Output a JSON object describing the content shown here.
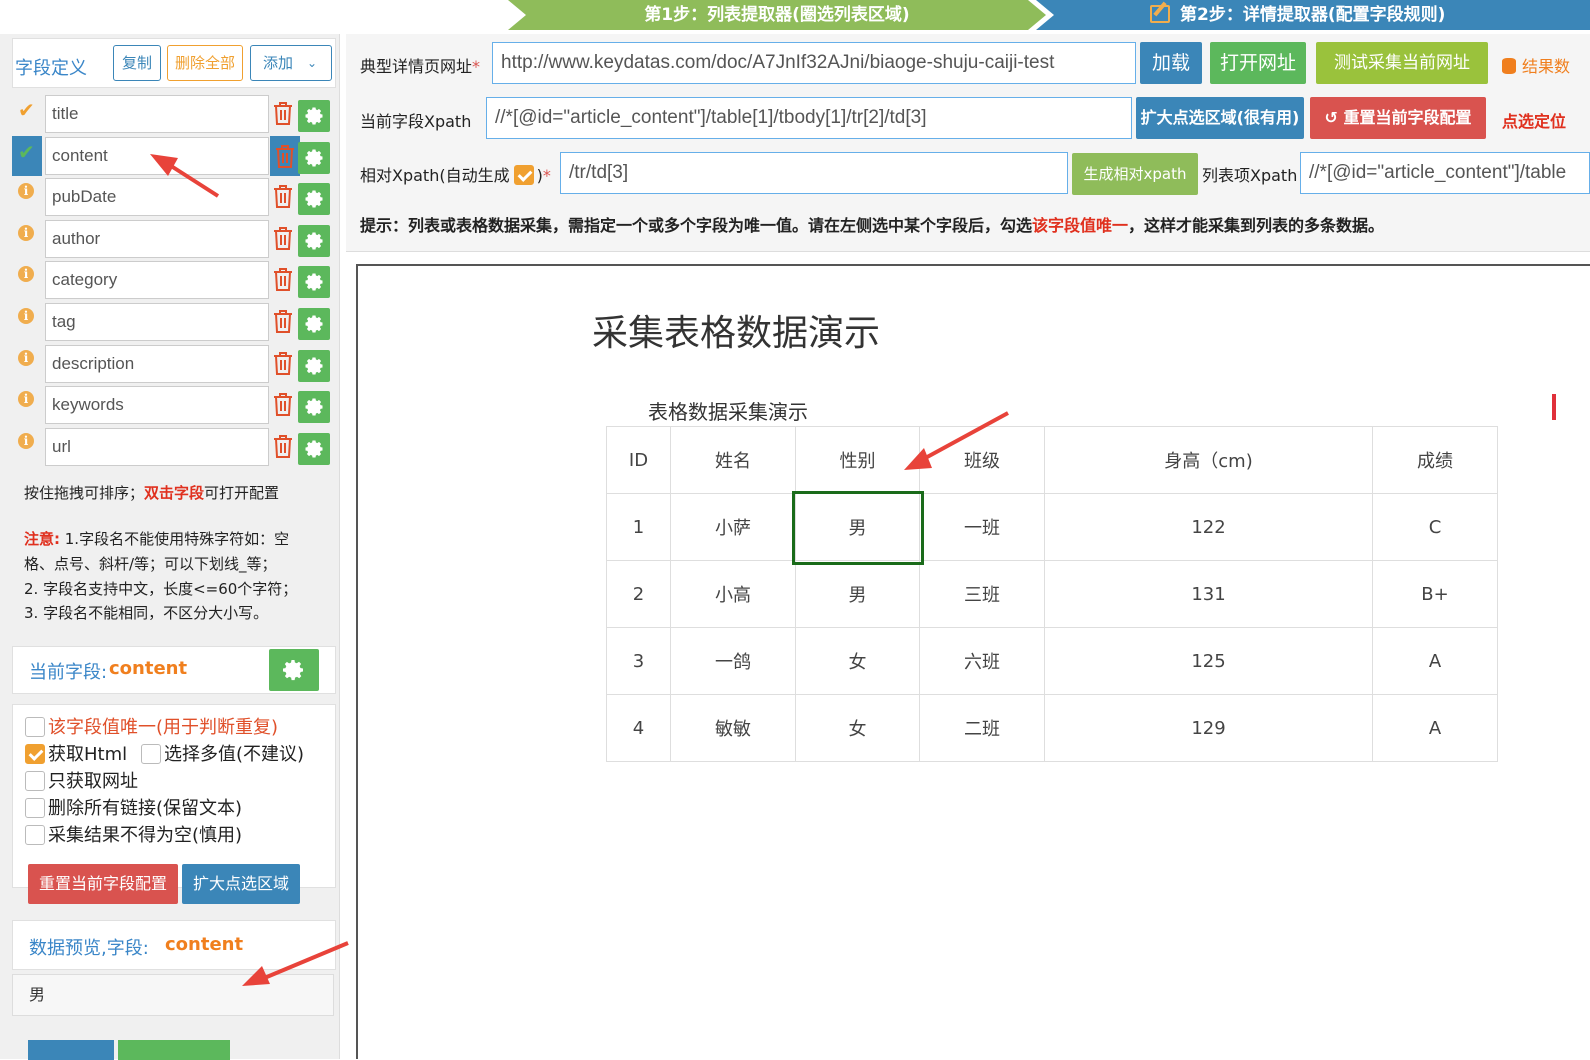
{
  "steps": {
    "step1": "第1步：列表提取器(圈选列表区域)",
    "step2": "第2步：详情提取器(配置字段规则)"
  },
  "fields_panel": {
    "title": "字段定义",
    "copy_label": "复制",
    "delete_all_label": "删除全部",
    "add_label": "添加",
    "fields": [
      {
        "name": "title",
        "status": "check"
      },
      {
        "name": "content",
        "status": "selected"
      },
      {
        "name": "pubDate",
        "status": "info"
      },
      {
        "name": "author",
        "status": "info"
      },
      {
        "name": "category",
        "status": "info"
      },
      {
        "name": "tag",
        "status": "info"
      },
      {
        "name": "description",
        "status": "info"
      },
      {
        "name": "keywords",
        "status": "info"
      },
      {
        "name": "url",
        "status": "info"
      }
    ],
    "hint_prefix": "按住拖拽可排序；",
    "hint_highlight": "双击字段",
    "hint_suffix": "可打开配置",
    "note_label": "注意:",
    "note_line1": " 1.字段名不能使用特殊字符如：空",
    "note_line2": "格、点号、斜杆/等；可以下划线_等；",
    "note_line3": "2. 字段名支持中文，长度<=60个字符；",
    "note_line4": "3. 字段名不能相同，不区分大小写。"
  },
  "current_field": {
    "label": "当前字段:",
    "name": "content",
    "options": {
      "unique": "该字段值唯一(用于判断重复)",
      "get_html": "获取Html",
      "multi_value": "选择多值(不建议)",
      "url_only": "只获取网址",
      "remove_links": "删除所有链接(保留文本)",
      "not_empty": "采集结果不得为空(慎用)"
    },
    "checked": {
      "unique": false,
      "get_html": true,
      "multi_value": false,
      "url_only": false,
      "remove_links": false,
      "not_empty": false
    },
    "reset_label": "重置当前字段配置",
    "expand_label": "扩大点选区域"
  },
  "preview": {
    "label": "数据预览,字段:",
    "field": "content",
    "value": "男"
  },
  "config": {
    "detail_url_label": "典型详情页网址",
    "detail_url_value": "http://www.keydatas.com/doc/A7JnIf32AJni/biaoge-shuju-caiji-test",
    "load_label": "加载",
    "open_label": "打开网址",
    "test_label": "测试采集当前网址",
    "result_label": "结果数",
    "xpath_label": "当前字段Xpath",
    "xpath_value": "//*[@id=\"article_content\"]/table[1]/tbody[1]/tr[2]/td[3]",
    "expand_label": "扩大点选区域(很有用)",
    "reset_label": "重置当前字段配置",
    "pick_label": "点选定位",
    "rel_xpath_label": "相对Xpath(自动生成",
    "rel_xpath_suffix": ")",
    "rel_xpath_value": "/tr/td[3]",
    "gen_rel_label": "生成相对xpath",
    "list_xpath_label": "列表项Xpath",
    "list_xpath_value": "//*[@id=\"article_content\"]/table",
    "tip_prefix": "提示：列表或表格数据采集，需指定一个或多个字段为唯一值。请在左侧选中某个字段后，勾选",
    "tip_highlight": "该字段值唯一",
    "tip_suffix": "，这样才能采集到列表的多条数据。"
  },
  "webpage": {
    "title": "采集表格数据演示",
    "caption": "表格数据采集演示",
    "headers": [
      "ID",
      "姓名",
      "性别",
      "班级",
      "身高（cm)",
      "成绩"
    ],
    "rows": [
      [
        "1",
        "小萨",
        "男",
        "一班",
        "122",
        "C"
      ],
      [
        "2",
        "小高",
        "男",
        "三班",
        "131",
        "B+"
      ],
      [
        "3",
        "一鸽",
        "女",
        "六班",
        "125",
        "A"
      ],
      [
        "4",
        "敏敏",
        "女",
        "二班",
        "129",
        "A"
      ]
    ]
  },
  "colors": {
    "step1": "#8fbc5a",
    "step2": "#3b86b8",
    "primary": "#3b86b8",
    "success": "#5cb85c",
    "olive": "#9ac23c",
    "danger": "#d9534f",
    "warning": "#f0a030",
    "selection": "#1a6b1a",
    "arrow": "#e8433a"
  }
}
